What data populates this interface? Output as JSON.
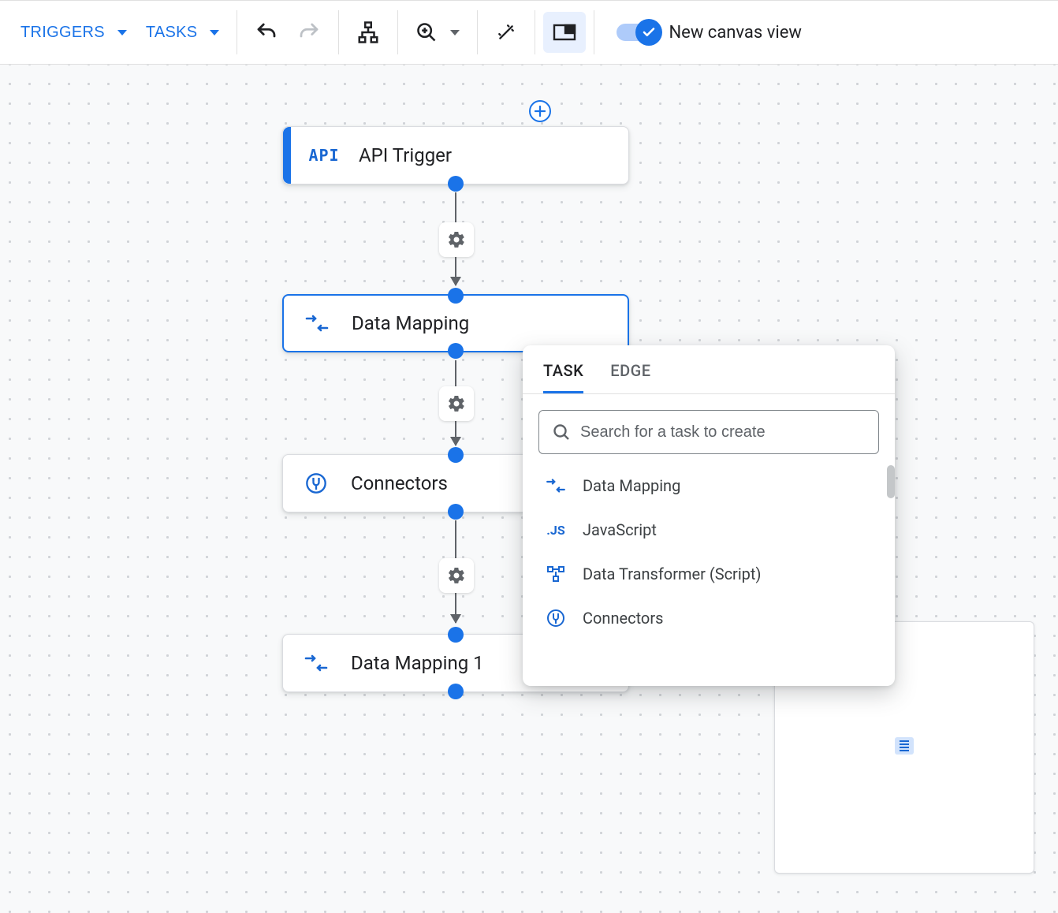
{
  "toolbar": {
    "triggers_label": "TRIGGERS",
    "tasks_label": "TASKS",
    "new_canvas_label": "New canvas view"
  },
  "nodes": {
    "api_trigger": {
      "label": "API Trigger",
      "icon_text": "API"
    },
    "data_mapping": {
      "label": "Data Mapping"
    },
    "connectors": {
      "label": "Connectors"
    },
    "data_mapping_1": {
      "label": "Data Mapping 1"
    }
  },
  "popup": {
    "tabs": {
      "task": "TASK",
      "edge": "EDGE"
    },
    "search_placeholder": "Search for a task to create",
    "items": [
      {
        "label": "Data Mapping",
        "icon": "mapping"
      },
      {
        "label": "JavaScript",
        "icon": "js"
      },
      {
        "label": "Data Transformer (Script)",
        "icon": "transformer"
      },
      {
        "label": "Connectors",
        "icon": "connector"
      }
    ]
  }
}
